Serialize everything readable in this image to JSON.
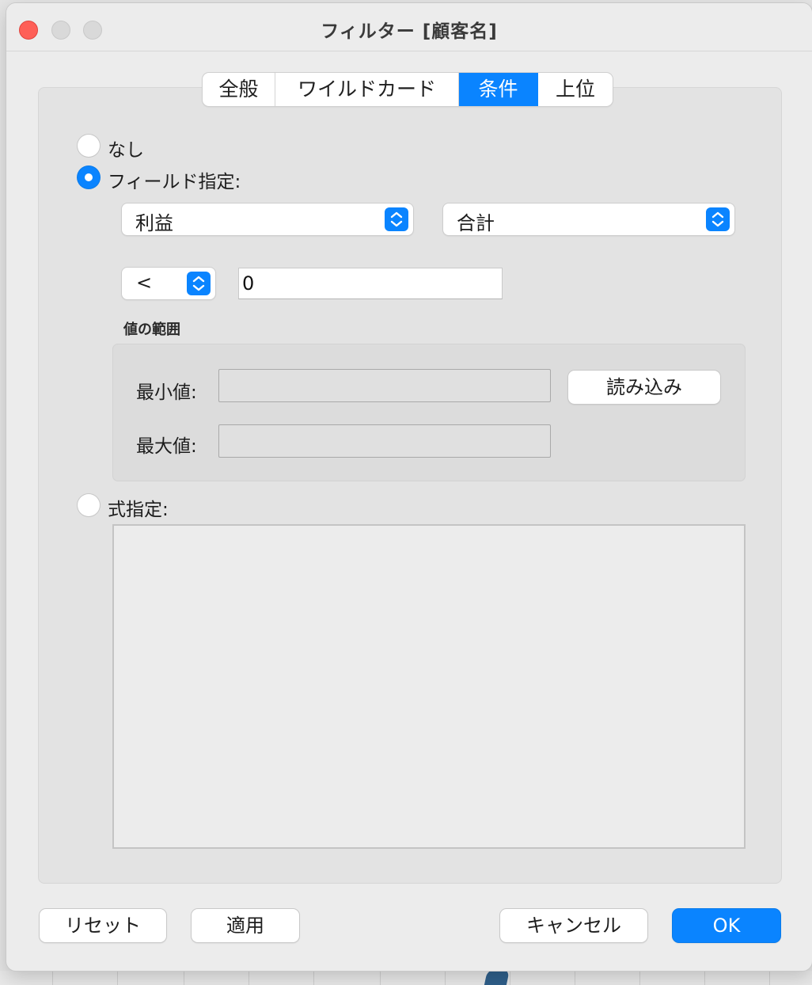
{
  "window": {
    "title": "フィルター [顧客名]"
  },
  "tabs": [
    {
      "label": "全般",
      "active": false
    },
    {
      "label": "ワイルドカード",
      "active": false
    },
    {
      "label": "条件",
      "active": true
    },
    {
      "label": "上位",
      "active": false
    }
  ],
  "condition": {
    "none_label": "なし",
    "by_field_label": "フィールド指定:",
    "selected_mode": "by_field",
    "field_select_value": "利益",
    "aggregation_select_value": "合計",
    "operator_select_value": "<",
    "value_input": "0",
    "range": {
      "heading": "値の範囲",
      "min_label": "最小値:",
      "max_label": "最大値:",
      "min_value": "",
      "max_value": "",
      "load_button": "読み込み"
    },
    "by_formula_label": "式指定:",
    "formula_text": ""
  },
  "footer": {
    "reset": "リセット",
    "apply": "適用",
    "cancel": "キャンセル",
    "ok": "OK"
  },
  "colors": {
    "accent": "#0a84ff",
    "close": "#fe5f57"
  }
}
